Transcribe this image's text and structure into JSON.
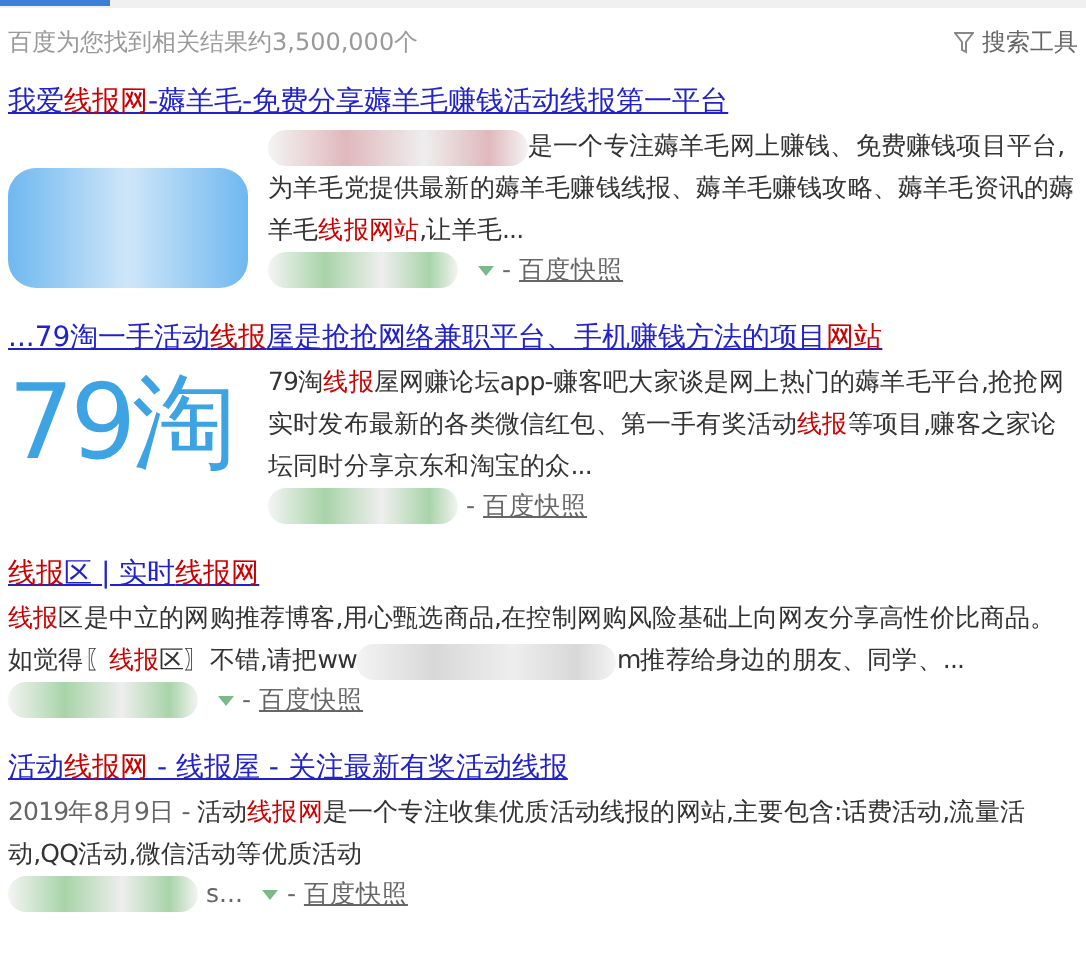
{
  "stats": "百度为您找到相关结果约3,500,000个",
  "tools": "搜索工具",
  "results": [
    {
      "title": [
        {
          "kind": "text",
          "t": "我爱"
        },
        {
          "kind": "highlight",
          "t": "线报网"
        },
        {
          "kind": "text",
          "t": "-薅羊毛-免费分享薅羊毛赚钱活动线报第一平台"
        }
      ],
      "thumbnail": {
        "kind": "blurred",
        "color": "#6fb8f0"
      },
      "snippet": [
        {
          "kind": "redacted",
          "color": "#e0b8bc"
        },
        {
          "kind": "text",
          "t": "是一个专注薅羊毛网上赚钱、免费赚钱项目平台,为羊毛党提供最新的薅羊毛赚钱线报、薅羊毛赚钱攻略、薅羊毛资讯的薅羊毛"
        },
        {
          "kind": "highlight",
          "t": "线报网站"
        },
        {
          "kind": "text",
          "t": ",让羊毛..."
        }
      ],
      "url": [
        {
          "kind": "redacted",
          "color": "#a8d4a8"
        }
      ],
      "dropdown": true,
      "separator": "-",
      "snapshot": "百度快照"
    },
    {
      "title": [
        {
          "kind": "text",
          "t": "...79淘一手活动"
        },
        {
          "kind": "highlight",
          "t": "线报"
        },
        {
          "kind": "text",
          "t": "屋是抢抢网络兼职平台、手机赚钱方法的项目"
        },
        {
          "kind": "highlight",
          "t": "网站"
        }
      ],
      "thumbnail": {
        "kind": "logo",
        "text": "79淘"
      },
      "snippet": [
        {
          "kind": "text",
          "t": "79淘"
        },
        {
          "kind": "highlight",
          "t": "线报"
        },
        {
          "kind": "text",
          "t": "屋网赚论坛app-赚客吧大家谈是网上热门的薅羊毛平台,抢抢网实时发布最新的各类微信红包、第一手有奖活动"
        },
        {
          "kind": "highlight",
          "t": "线报"
        },
        {
          "kind": "text",
          "t": "等项目,赚客之家论坛同时分享京东和淘宝的众..."
        }
      ],
      "url": [
        {
          "kind": "redacted",
          "color": "#a8d4a8"
        }
      ],
      "dropdown": false,
      "separator": "-",
      "snapshot": "百度快照"
    },
    {
      "title": [
        {
          "kind": "highlight",
          "t": "线报"
        },
        {
          "kind": "text",
          "t": "区 | 实时"
        },
        {
          "kind": "highlight",
          "t": "线报网"
        }
      ],
      "snippet": [
        {
          "kind": "highlight",
          "t": "线报"
        },
        {
          "kind": "text",
          "t": "区是中立的网购推荐博客,用心甄选商品,在控制网购风险基础上向网友分享高性价比商品。如觉得〖"
        },
        {
          "kind": "highlight",
          "t": "线报"
        },
        {
          "kind": "text",
          "t": "区〗不错,请把ww"
        },
        {
          "kind": "redacted",
          "color": "#d8d8d8"
        },
        {
          "kind": "text",
          "t": "m推荐给身边的朋友、同学、..."
        }
      ],
      "url": [
        {
          "kind": "redacted",
          "color": "#a8d4a8"
        }
      ],
      "dropdown": true,
      "separator": "-",
      "snapshot": "百度快照"
    },
    {
      "title": [
        {
          "kind": "text",
          "t": "活动"
        },
        {
          "kind": "highlight",
          "t": "线报网"
        },
        {
          "kind": "text",
          "t": " - 线报屋 - 关注最新有奖活动线报"
        }
      ],
      "snippet": [
        {
          "kind": "date",
          "t": "2019年8月9日 - "
        },
        {
          "kind": "text",
          "t": "活动"
        },
        {
          "kind": "highlight",
          "t": "线报网"
        },
        {
          "kind": "text",
          "t": "是一个专注收集优质活动线报的网站,主要包含:话费活动,流量活动,QQ活动,微信活动等优质活动"
        }
      ],
      "url": [
        {
          "kind": "redacted",
          "color": "#a8d4a8"
        },
        {
          "kind": "text",
          "t": "s..."
        }
      ],
      "dropdown": true,
      "separator": "-",
      "snapshot": "百度快照"
    }
  ]
}
